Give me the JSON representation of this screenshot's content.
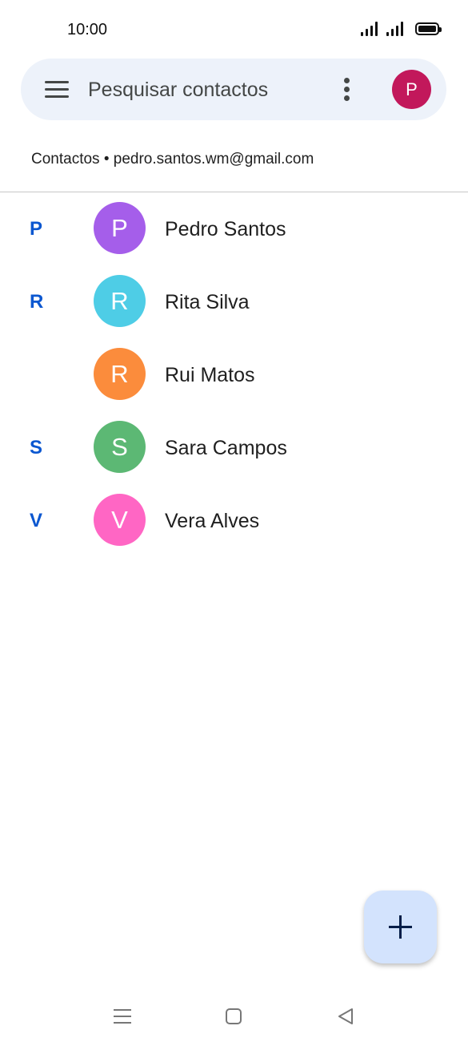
{
  "status_bar": {
    "time": "10:00"
  },
  "search": {
    "placeholder": "Pesquisar contactos",
    "profile_initial": "P",
    "profile_color": "#c2185b"
  },
  "account": {
    "label": "Contactos • pedro.santos.wm@gmail.com"
  },
  "contacts": [
    {
      "section": "P",
      "initial": "P",
      "name": "Pedro Santos",
      "color": "#a55eea"
    },
    {
      "section": "R",
      "initial": "R",
      "name": "Rita Silva",
      "color": "#4ecde6"
    },
    {
      "section": "",
      "initial": "R",
      "name": "Rui Matos",
      "color": "#fb8c3c"
    },
    {
      "section": "S",
      "initial": "S",
      "name": "Sara Campos",
      "color": "#5cb874"
    },
    {
      "section": "V",
      "initial": "V",
      "name": "Vera Alves",
      "color": "#ff66c4"
    }
  ],
  "icons": {
    "menu": "menu-icon",
    "more": "more-vert-icon",
    "add": "plus-icon",
    "nav_recents": "recents-icon",
    "nav_home": "home-icon",
    "nav_back": "back-icon"
  },
  "colors": {
    "accent": "#0b57d0",
    "search_bg": "#edf2fa",
    "fab_bg": "#d3e3fd"
  }
}
